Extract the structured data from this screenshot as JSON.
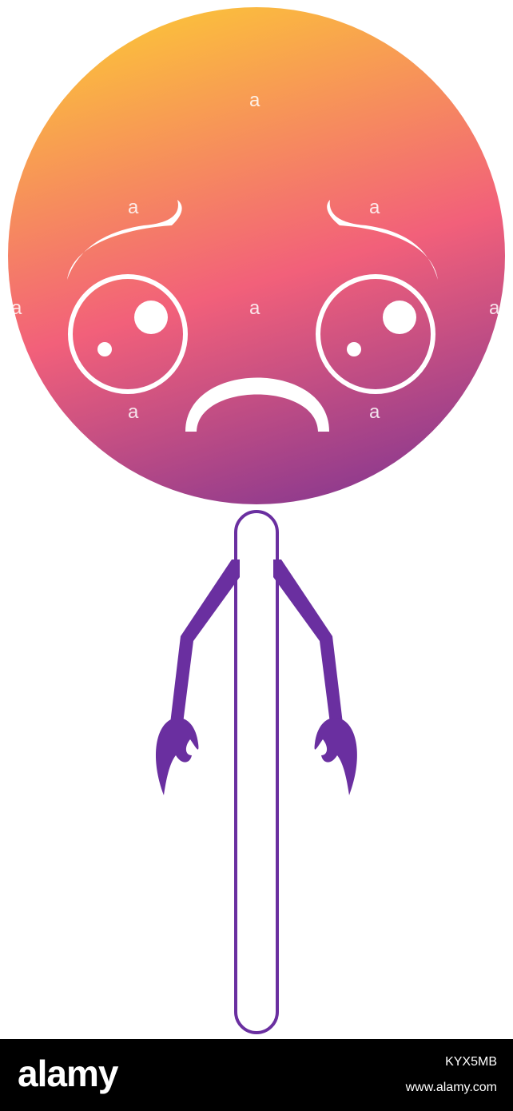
{
  "illustration": {
    "subject": "sad-lollipop-kawaii",
    "colors": {
      "gradient_top": "#FBBF3C",
      "gradient_mid": "#F2607A",
      "gradient_bottom": "#8E3A8E",
      "stick_and_arms": "#6A2FA0",
      "face_lines": "#ffffff"
    }
  },
  "watermark": {
    "glyph": "a"
  },
  "footer": {
    "logo_text": "alamy",
    "image_code": "KYX5MB",
    "url": "www.alamy.com"
  }
}
